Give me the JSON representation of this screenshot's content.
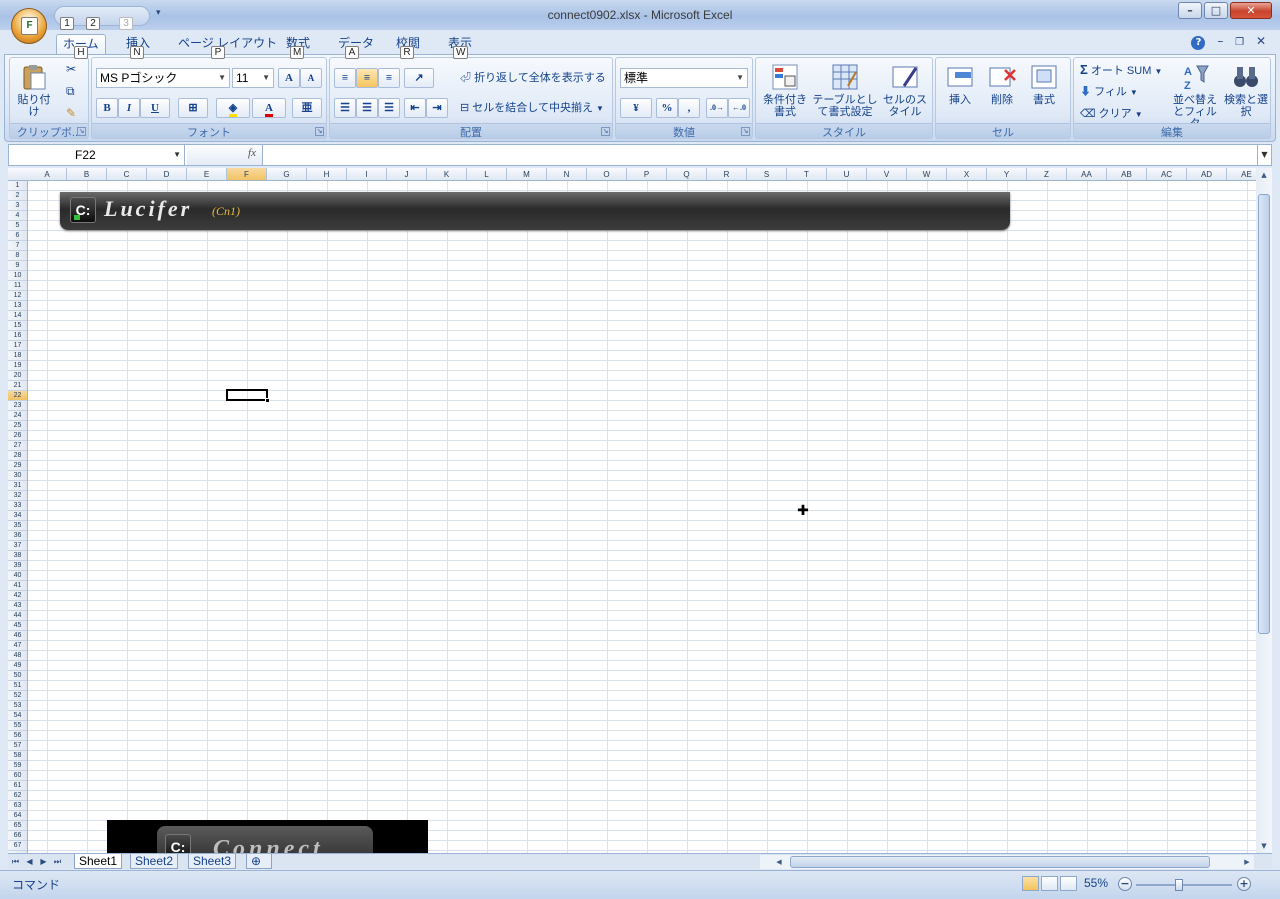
{
  "window": {
    "title": "connect0902.xlsx - Microsoft Excel",
    "office_button_letter": "F",
    "minimize": "–",
    "maximize": "□",
    "close": "✕"
  },
  "qat": {
    "keytips": [
      "1",
      "2",
      "3"
    ]
  },
  "tabs": [
    {
      "label": "ホーム",
      "key": "H"
    },
    {
      "label": "挿入",
      "key": "N"
    },
    {
      "label": "ページ レイアウト",
      "key": "P"
    },
    {
      "label": "数式",
      "key": "M"
    },
    {
      "label": "データ",
      "key": "A"
    },
    {
      "label": "校閲",
      "key": "R"
    },
    {
      "label": "表示",
      "key": "W"
    }
  ],
  "ribbon": {
    "clipboard": {
      "label": "クリップボ...",
      "paste": "貼り付け"
    },
    "font": {
      "label": "フォント",
      "name": "MS Pゴシック",
      "size": "11",
      "bold": "B",
      "italic": "I",
      "underline": "U",
      "grow": "A",
      "shrink": "A",
      "color_letter": "A"
    },
    "alignment": {
      "label": "配置",
      "wrap": "折り返して全体を表示する",
      "merge": "セルを結合して中央揃え"
    },
    "number": {
      "label": "数値",
      "format": "標準",
      "percent": "%",
      "comma": ","
    },
    "styles": {
      "label": "スタイル",
      "conditional": "条件付き書式",
      "table": "テーブルとして書式設定",
      "cell": "セルのスタイル"
    },
    "cells": {
      "label": "セル",
      "insert": "挿入",
      "delete": "削除",
      "format": "書式"
    },
    "editing": {
      "label": "編集",
      "autosum": "オート SUM",
      "fill": "フィル",
      "clear": "クリア",
      "sort": "並べ替えとフィルタ",
      "find": "検索と選択"
    }
  },
  "formula_bar": {
    "name_box": "F22",
    "fx": "fx",
    "value": ""
  },
  "grid": {
    "columns": [
      "A",
      "B",
      "C",
      "D",
      "E",
      "F",
      "G",
      "H",
      "I",
      "J",
      "K",
      "L",
      "M",
      "N",
      "O",
      "P",
      "Q",
      "R",
      "S",
      "T",
      "U",
      "V",
      "W",
      "X",
      "Y",
      "Z",
      "AA",
      "AB",
      "AC",
      "AD",
      "AE"
    ],
    "selected_column": "F",
    "row_count": 67,
    "selected_row": 22
  },
  "banner1": {
    "logo": "C:",
    "text": "Lucifer",
    "sub": "(Cn1)"
  },
  "banner2": {
    "logo": "C:",
    "text": "Connect"
  },
  "sheets": [
    "Sheet1",
    "Sheet2",
    "Sheet3"
  ],
  "status": {
    "mode": "コマンド",
    "zoom": "55%",
    "zoom_fraction": 0.45
  }
}
